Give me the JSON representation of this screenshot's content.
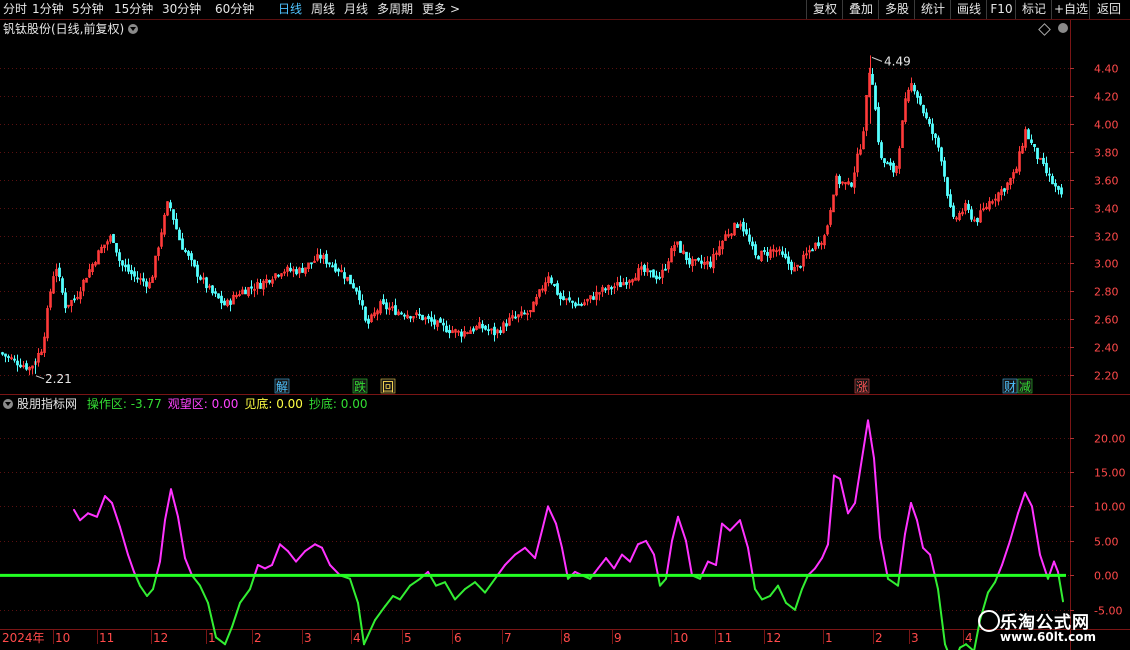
{
  "toolbar": {
    "periods": [
      "分时",
      "1分钟",
      "5分钟",
      "15分钟",
      "30分钟",
      "60分钟",
      "日线",
      "周线",
      "月线",
      "多周期",
      "更多"
    ],
    "active_period": "日线",
    "more_arrow": ">",
    "right_buttons": [
      "复权",
      "叠加",
      "多股",
      "统计",
      "画线",
      "F10",
      "标记",
      "+自选",
      "返回"
    ]
  },
  "main_chart": {
    "title": "钒钛股份(日线,前复权)",
    "y_ticks": [
      "4.40",
      "4.20",
      "4.00",
      "3.80",
      "3.60",
      "3.40",
      "3.20",
      "3.00",
      "2.80",
      "2.60",
      "2.40",
      "2.20"
    ],
    "high_label": "4.49",
    "low_label": "2.21",
    "markers": [
      {
        "text": "解",
        "color": "#4fc3ff"
      },
      {
        "text": "跌",
        "color": "#33dd33"
      },
      {
        "text": "回",
        "color": "#ffdd55"
      },
      {
        "text": "涨",
        "color": "#ff5555"
      },
      {
        "text": "财",
        "color": "#4fc3ff"
      },
      {
        "text": "减",
        "color": "#33dd33"
      }
    ]
  },
  "indicator": {
    "name": "股朋指标网",
    "items": [
      {
        "label": "操作区:",
        "value": "-3.77",
        "color": "#33dd33"
      },
      {
        "label": "观望区:",
        "value": "0.00",
        "color": "#ff44ff"
      },
      {
        "label": "见底:",
        "value": "0.00",
        "color": "#ffff44"
      },
      {
        "label": "抄底:",
        "value": "0.00",
        "color": "#33dd33"
      }
    ],
    "y_ticks": [
      "20.00",
      "15.00",
      "10.00",
      "5.00",
      "0.00",
      "-5.00"
    ]
  },
  "x_axis": {
    "labels": [
      "2024年",
      "10",
      "11",
      "12",
      "1",
      "2",
      "3",
      "4",
      "5",
      "6",
      "7",
      "8",
      "9",
      "10",
      "11",
      "12",
      "1",
      "2",
      "3",
      "4"
    ]
  },
  "watermark": {
    "line1": "乐淘公式网",
    "line2": "www.60lt.com"
  },
  "chart_data": [
    {
      "type": "candlestick",
      "title": "钒钛股份(日线,前复权)",
      "ylim": [
        2.13,
        4.6
      ],
      "close_path": [
        [
          0,
          2.36
        ],
        [
          15,
          2.3
        ],
        [
          30,
          2.25
        ],
        [
          42,
          2.4
        ],
        [
          50,
          2.8
        ],
        [
          55,
          3.0
        ],
        [
          65,
          2.7
        ],
        [
          75,
          2.75
        ],
        [
          85,
          2.9
        ],
        [
          100,
          3.1
        ],
        [
          112,
          3.2
        ],
        [
          120,
          3.0
        ],
        [
          135,
          2.9
        ],
        [
          150,
          2.85
        ],
        [
          160,
          3.2
        ],
        [
          168,
          3.45
        ],
        [
          180,
          3.15
        ],
        [
          195,
          2.95
        ],
        [
          210,
          2.8
        ],
        [
          225,
          2.7
        ],
        [
          240,
          2.8
        ],
        [
          260,
          2.85
        ],
        [
          280,
          2.95
        ],
        [
          300,
          2.95
        ],
        [
          320,
          3.05
        ],
        [
          340,
          2.95
        ],
        [
          358,
          2.8
        ],
        [
          366,
          2.55
        ],
        [
          380,
          2.7
        ],
        [
          400,
          2.65
        ],
        [
          420,
          2.62
        ],
        [
          440,
          2.55
        ],
        [
          460,
          2.5
        ],
        [
          480,
          2.55
        ],
        [
          495,
          2.5
        ],
        [
          510,
          2.6
        ],
        [
          530,
          2.65
        ],
        [
          548,
          2.92
        ],
        [
          560,
          2.75
        ],
        [
          580,
          2.7
        ],
        [
          600,
          2.8
        ],
        [
          620,
          2.85
        ],
        [
          640,
          2.95
        ],
        [
          660,
          2.9
        ],
        [
          675,
          3.15
        ],
        [
          690,
          3.0
        ],
        [
          710,
          3.0
        ],
        [
          725,
          3.2
        ],
        [
          740,
          3.3
        ],
        [
          755,
          3.05
        ],
        [
          775,
          3.1
        ],
        [
          795,
          2.95
        ],
        [
          810,
          3.1
        ],
        [
          825,
          3.2
        ],
        [
          835,
          3.6
        ],
        [
          850,
          3.55
        ],
        [
          862,
          3.9
        ],
        [
          870,
          4.45
        ],
        [
          880,
          3.75
        ],
        [
          895,
          3.65
        ],
        [
          905,
          4.15
        ],
        [
          912,
          4.3
        ],
        [
          925,
          4.05
        ],
        [
          940,
          3.8
        ],
        [
          952,
          3.3
        ],
        [
          965,
          3.4
        ],
        [
          975,
          3.3
        ],
        [
          990,
          3.45
        ],
        [
          1005,
          3.55
        ],
        [
          1015,
          3.65
        ],
        [
          1025,
          3.95
        ],
        [
          1038,
          3.75
        ],
        [
          1050,
          3.6
        ],
        [
          1063,
          3.45
        ]
      ]
    },
    {
      "type": "line",
      "name": "股朋指标网",
      "ylim": [
        -7.5,
        24
      ],
      "zero_line": 0,
      "series_points": [
        [
          74,
          9.5
        ],
        [
          80,
          8.0
        ],
        [
          88,
          9.0
        ],
        [
          97,
          8.5
        ],
        [
          105,
          11.5
        ],
        [
          112,
          10.5
        ],
        [
          120,
          7.0
        ],
        [
          128,
          3.0
        ],
        [
          134,
          0.5
        ],
        [
          140,
          -1.5
        ],
        [
          147,
          -3.0
        ],
        [
          153,
          -2.0
        ],
        [
          160,
          2.0
        ],
        [
          165,
          8.0
        ],
        [
          171,
          12.5
        ],
        [
          178,
          8.5
        ],
        [
          185,
          2.5
        ],
        [
          192,
          0.0
        ],
        [
          200,
          -1.5
        ],
        [
          208,
          -4.0
        ],
        [
          216,
          -9.0
        ],
        [
          225,
          -10.0
        ],
        [
          232,
          -7.5
        ],
        [
          240,
          -4.0
        ],
        [
          250,
          -2.0
        ],
        [
          258,
          1.5
        ],
        [
          265,
          1.0
        ],
        [
          272,
          1.5
        ],
        [
          280,
          4.5
        ],
        [
          288,
          3.5
        ],
        [
          296,
          2.0
        ],
        [
          305,
          3.5
        ],
        [
          315,
          4.5
        ],
        [
          322,
          4.0
        ],
        [
          330,
          1.5
        ],
        [
          340,
          0.0
        ],
        [
          350,
          -0.5
        ],
        [
          358,
          -4.0
        ],
        [
          364,
          -10.0
        ],
        [
          375,
          -6.5
        ],
        [
          385,
          -4.5
        ],
        [
          393,
          -3.0
        ],
        [
          400,
          -3.5
        ],
        [
          410,
          -1.5
        ],
        [
          420,
          -0.5
        ],
        [
          428,
          0.5
        ],
        [
          436,
          -1.5
        ],
        [
          445,
          -1.0
        ],
        [
          455,
          -3.5
        ],
        [
          465,
          -2.0
        ],
        [
          475,
          -1.0
        ],
        [
          485,
          -2.5
        ],
        [
          495,
          -0.5
        ],
        [
          505,
          1.5
        ],
        [
          515,
          3.0
        ],
        [
          525,
          4.0
        ],
        [
          535,
          2.5
        ],
        [
          542,
          6.5
        ],
        [
          548,
          10.0
        ],
        [
          556,
          7.5
        ],
        [
          562,
          4.0
        ],
        [
          568,
          -0.5
        ],
        [
          575,
          0.5
        ],
        [
          582,
          0.0
        ],
        [
          590,
          -0.5
        ],
        [
          598,
          1.0
        ],
        [
          606,
          2.5
        ],
        [
          614,
          1.0
        ],
        [
          622,
          3.0
        ],
        [
          630,
          2.0
        ],
        [
          638,
          4.5
        ],
        [
          646,
          5.0
        ],
        [
          654,
          3.0
        ],
        [
          660,
          -1.5
        ],
        [
          666,
          -0.5
        ],
        [
          672,
          5.0
        ],
        [
          678,
          8.5
        ],
        [
          686,
          5.0
        ],
        [
          692,
          0.0
        ],
        [
          700,
          -0.5
        ],
        [
          708,
          2.0
        ],
        [
          716,
          1.5
        ],
        [
          722,
          7.5
        ],
        [
          730,
          6.5
        ],
        [
          740,
          8.0
        ],
        [
          748,
          4.0
        ],
        [
          755,
          -2.0
        ],
        [
          762,
          -3.5
        ],
        [
          770,
          -3.0
        ],
        [
          778,
          -1.5
        ],
        [
          786,
          -4.0
        ],
        [
          795,
          -5.0
        ],
        [
          802,
          -2.0
        ],
        [
          808,
          0.0
        ],
        [
          815,
          1.0
        ],
        [
          822,
          2.5
        ],
        [
          828,
          4.5
        ],
        [
          834,
          14.5
        ],
        [
          840,
          14.0
        ],
        [
          848,
          9.0
        ],
        [
          855,
          10.5
        ],
        [
          862,
          17.0
        ],
        [
          868,
          22.5
        ],
        [
          874,
          17.0
        ],
        [
          880,
          5.5
        ],
        [
          888,
          -0.5
        ],
        [
          898,
          -1.5
        ],
        [
          905,
          6.0
        ],
        [
          911,
          10.5
        ],
        [
          917,
          8.0
        ],
        [
          923,
          4.0
        ],
        [
          930,
          3.0
        ],
        [
          938,
          -2.0
        ],
        [
          945,
          -10.0
        ],
        [
          953,
          -13.0
        ],
        [
          960,
          -10.5
        ],
        [
          966,
          -10.0
        ],
        [
          974,
          -11.0
        ],
        [
          980,
          -6.5
        ],
        [
          988,
          -2.5
        ],
        [
          995,
          -1.0
        ],
        [
          1002,
          1.5
        ],
        [
          1010,
          5.0
        ],
        [
          1018,
          9.0
        ],
        [
          1025,
          12.0
        ],
        [
          1032,
          10.0
        ],
        [
          1040,
          3.0
        ],
        [
          1048,
          -0.5
        ],
        [
          1054,
          2.0
        ],
        [
          1058,
          0.5
        ],
        [
          1063,
          -3.77
        ]
      ]
    }
  ]
}
